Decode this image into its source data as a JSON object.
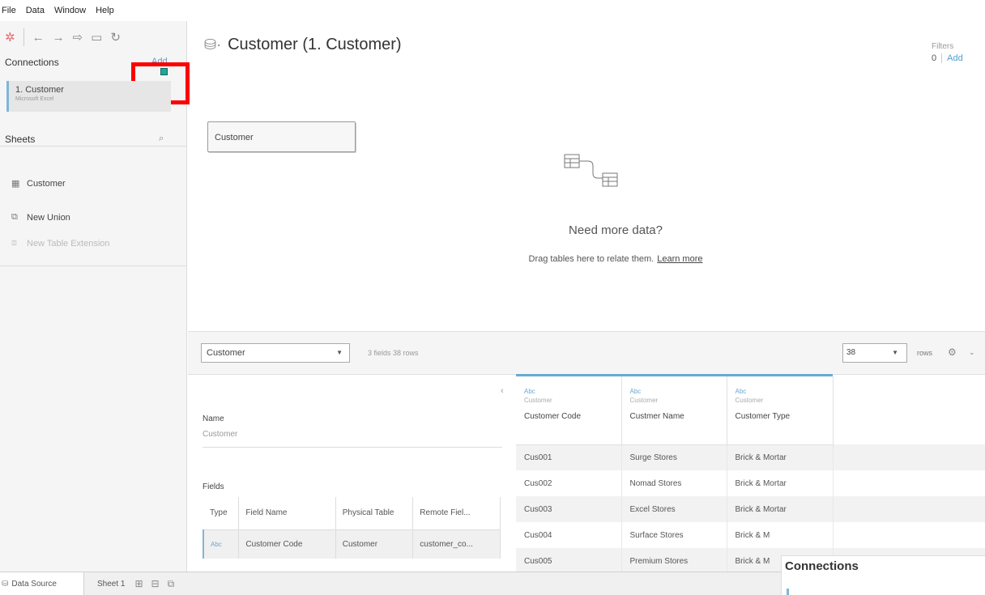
{
  "menu": [
    "File",
    "Data",
    "Window",
    "Help"
  ],
  "toolbar": {
    "logo_icon": "✲",
    "back_icon": "←",
    "forward_icon": "→",
    "save_icon": "▭",
    "refresh_icon": "↻"
  },
  "left": {
    "connections_header": "Connections",
    "connections_add": "Add",
    "connection_name": "1. Customer",
    "connection_sub": "Microsoft Excel",
    "sheets_header": "Sheets",
    "sheets": [
      {
        "label": "Customer",
        "icon": "▦"
      },
      {
        "label": "New Union",
        "icon": "⧉"
      },
      {
        "label": "New Table Extension",
        "icon": "⧈"
      }
    ]
  },
  "canvas": {
    "title": "Customer (1. Customer)",
    "title_icon": "⛁·",
    "filters_label": "Filters",
    "filters_count": "0",
    "filters_add": "Add",
    "table_box": "Customer",
    "need_more": "Need more data?",
    "drag_text": "Drag tables here to relate them.",
    "learn_more": "Learn more"
  },
  "gridbar": {
    "table_select": "Customer",
    "fields_rows": "3 fields 38 rows",
    "rows_value": "38",
    "rows_label": "rows"
  },
  "metadata": {
    "name_label": "Name",
    "name_value": "Customer",
    "fields_label": "Fields",
    "columns": [
      "Type",
      "Field Name",
      "Physical Table",
      "Remote Fiel..."
    ],
    "rows": [
      {
        "type": "Abc",
        "field": "Customer Code",
        "table": "Customer",
        "remote": "customer_co..."
      }
    ]
  },
  "grid": {
    "type_tag": "Abc",
    "source": "Customer",
    "columns": [
      "Customer Code",
      "Custmer Name",
      "Customer Type"
    ],
    "rows": [
      [
        "Cus001",
        "Surge Stores",
        "Brick & Mortar"
      ],
      [
        "Cus002",
        "Nomad Stores",
        "Brick & Mortar"
      ],
      [
        "Cus003",
        "Excel Stores",
        "Brick & Mortar"
      ],
      [
        "Cus004",
        "Surface Stores",
        "Brick & M"
      ],
      [
        "Cus005",
        "Premium Stores",
        "Brick & M"
      ]
    ]
  },
  "tooltip": {
    "title": "Connections"
  },
  "tabs": {
    "data_source": "Data Source",
    "sheet1": "Sheet 1"
  }
}
